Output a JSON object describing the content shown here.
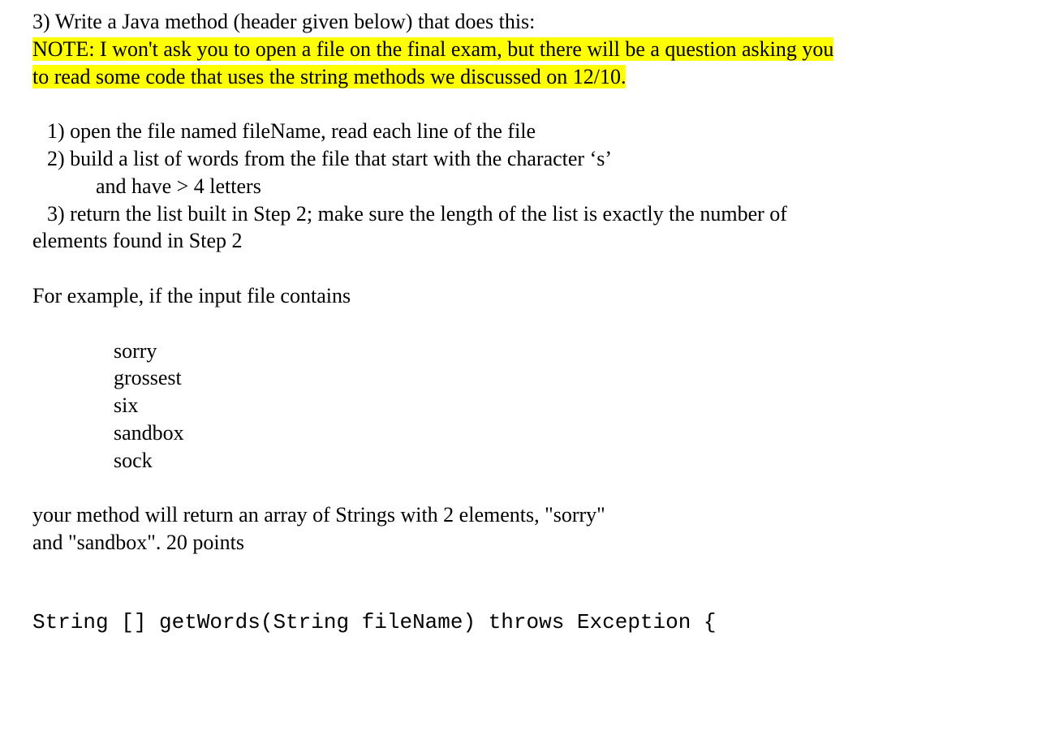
{
  "intro": "3) Write a Java method (header given below) that does this:",
  "noteLine1": "NOTE: I won't ask you to open a file on the final exam, but there will be a question asking you",
  "noteLine2": "to read some code that uses the string methods we discussed on 12/10.",
  "steps": {
    "s1": "1) open the file named fileName, read each line of the file",
    "s2a": "2) build a list of words from the file that start with the character ‘s’",
    "s2b": "and have > 4 letters",
    "s3a": "3) return the list built in Step 2; make sure the length of the list is exactly the number of",
    "s3b": "elements found in Step 2"
  },
  "exampleIntro": "For example, if the input file contains",
  "sample": {
    "w1": "sorry",
    "w2": "grossest",
    "w3": "six",
    "w4": "sandbox",
    "w5": "sock"
  },
  "outro1": "your method will return an array of Strings with 2 elements, \"sorry\"",
  "outro2": "and \"sandbox\". 20 points",
  "code": "String [] getWords(String fileName) throws Exception {"
}
